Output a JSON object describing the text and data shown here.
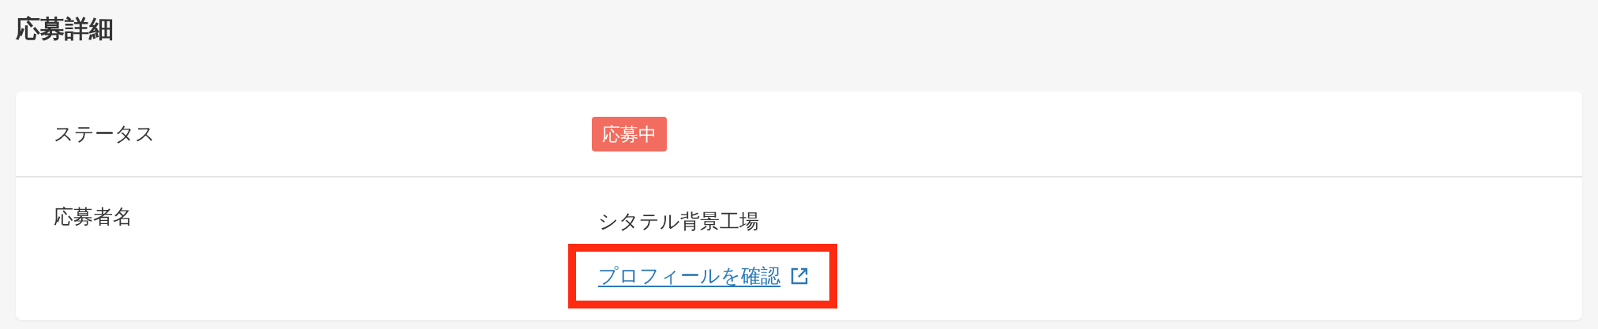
{
  "page_title": "応募詳細",
  "details": [
    {
      "label": "ステータス",
      "kind": "badge",
      "value": "応募中",
      "color": "#f26d5f"
    },
    {
      "label": "応募者名",
      "kind": "name",
      "value": "シタテル背景工場",
      "link": {
        "text": "プロフィールを確認",
        "highlighted": true
      }
    }
  ]
}
